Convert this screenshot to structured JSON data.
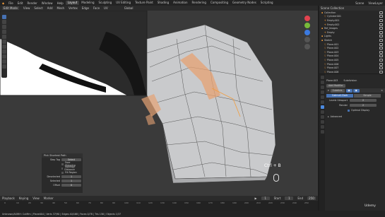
{
  "menubar": {
    "items": [
      "File",
      "Edit",
      "Render",
      "Window",
      "Help"
    ],
    "workspaces": [
      "Layout",
      "Modeling",
      "Sculpting",
      "UV Editing",
      "Texture Paint",
      "Shading",
      "Animation",
      "Rendering",
      "Compositing",
      "Geometry Nodes",
      "Scripting"
    ],
    "active_workspace": "Layout",
    "scene": "Scene",
    "view_layer": "ViewLayer"
  },
  "viewport_header": {
    "mode": "Edit Mode",
    "menus": [
      "View",
      "Select",
      "Add",
      "Mesh",
      "Vertex",
      "Edge",
      "Face",
      "UV"
    ],
    "orientation": "Global"
  },
  "operator_panel": {
    "title": "Pick Shortest Path",
    "step_label": "Step Tag",
    "step_value": "Select",
    "options": [
      "Face Stepping",
      "Topology Distance",
      "Fill Region"
    ],
    "fields": [
      {
        "label": "Deselected",
        "value": "1"
      },
      {
        "label": "Selected",
        "value": "1"
      },
      {
        "label": "Offset",
        "value": "0"
      }
    ]
  },
  "key_hint": "Ctrl + B",
  "timeline": {
    "menus": [
      "Playback",
      "Keying",
      "View",
      "Marker"
    ],
    "ticks": [
      "0",
      "10",
      "20",
      "30",
      "40",
      "50",
      "60",
      "70",
      "80",
      "90",
      "100",
      "110",
      "120",
      "130",
      "140",
      "150",
      "160",
      "170",
      "180",
      "190",
      "200",
      "210",
      "220",
      "230",
      "240",
      "250"
    ],
    "current_frame": "1",
    "start_label": "Start",
    "start": "1",
    "end_label": "End",
    "end": "250"
  },
  "statusbar": {
    "text": "Unknown/AXWH: CutMm | Plane004 | Verts 37/90 | Edges 40/168 | Faces 0/78 | Tris 156 | Objects 1/37"
  },
  "outliner": {
    "title": "Scene Collection",
    "items": [
      {
        "name": "Collection",
        "icon": "collection-icon"
      },
      {
        "name": "Cylinder001",
        "icon": "mesh-icon"
      },
      {
        "name": "Empty.001",
        "icon": "empty-icon"
      },
      {
        "name": "Empty.002",
        "icon": "empty-icon"
      },
      {
        "name": "Ref_Images",
        "icon": "collection-icon"
      },
      {
        "name": "Empty",
        "icon": "empty-icon"
      },
      {
        "name": "Lights",
        "icon": "collection-icon"
      },
      {
        "name": "Sketch",
        "icon": "collection-icon"
      },
      {
        "name": "Plane.001",
        "icon": "mesh-icon"
      },
      {
        "name": "Plane.002",
        "icon": "mesh-icon"
      },
      {
        "name": "Plane.003",
        "icon": "mesh-icon"
      },
      {
        "name": "Plane.004",
        "icon": "mesh-icon"
      },
      {
        "name": "Plane.005",
        "icon": "mesh-icon"
      },
      {
        "name": "Plane.006",
        "icon": "mesh-icon"
      },
      {
        "name": "Plane.007",
        "icon": "mesh-icon"
      },
      {
        "name": "Plane.008",
        "icon": "mesh-icon"
      }
    ]
  },
  "properties": {
    "object": "Plane.003",
    "modifier_name": "Subdivision",
    "add_modifier": "Add Modifier",
    "mod_name": "Subdivis",
    "types": [
      "Catmull-Clark",
      "Simple"
    ],
    "levels_viewport_label": "Levels Viewport",
    "levels_viewport": "2",
    "render_label": "Render",
    "render": "2",
    "optimal_display": "Optimal Display",
    "advanced": "Advanced"
  },
  "watermark": "Udemy",
  "colors": {
    "accent": "#4772b3",
    "orange": "#f39c3a",
    "mesh": "#c9cacc"
  }
}
